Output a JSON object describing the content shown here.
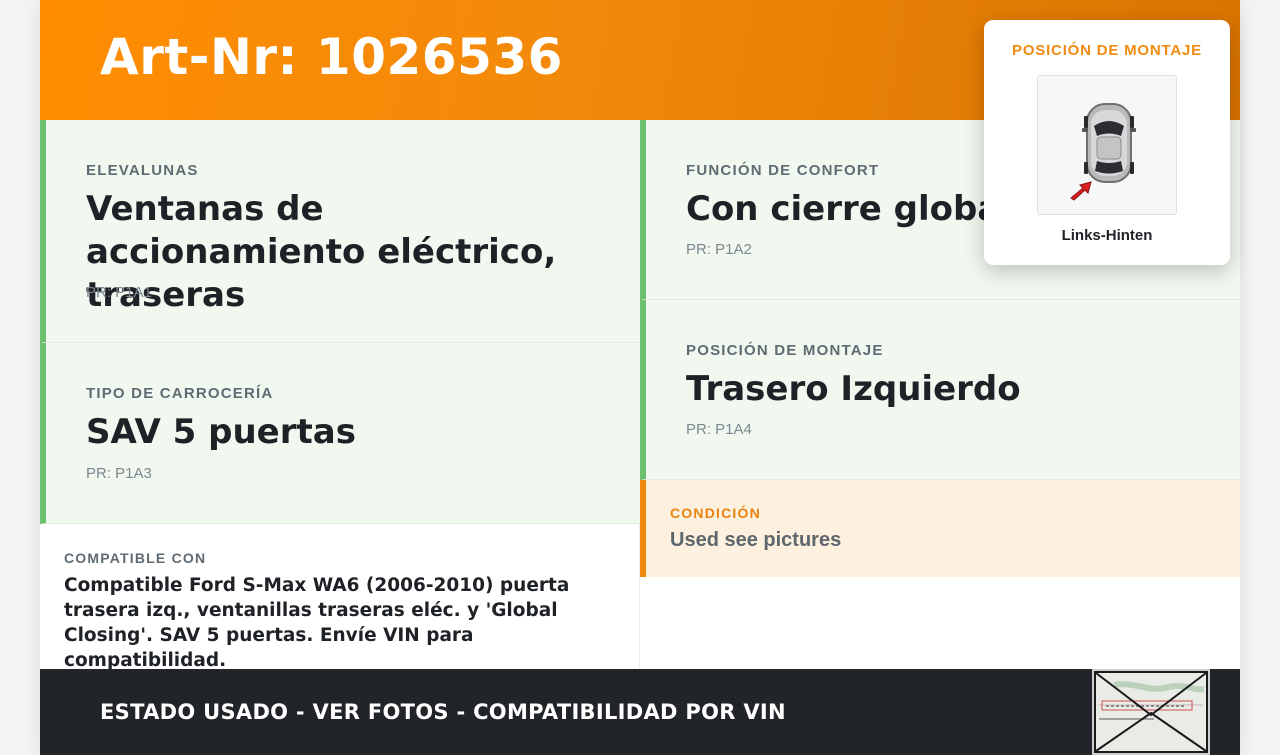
{
  "header": {
    "art_title": "Art-Nr: 1026536"
  },
  "cells": [
    {
      "label": "ELEVALUNAS",
      "value": "Ventanas de accionamiento eléctrico, traseras",
      "pr": "PR: P1A1"
    },
    {
      "label": "TIPO DE CARROCERÍA",
      "value": "SAV 5 puertas",
      "pr": "PR: P1A3"
    },
    {
      "label": "FUNCIÓN DE CONFORT",
      "value": "Con cierre global",
      "pr": "PR: P1A2"
    },
    {
      "label": "POSICIÓN DE MONTAJE",
      "value": "Trasero Izquierdo",
      "pr": "PR: P1A4"
    }
  ],
  "condition": {
    "label": "CONDICIÓN",
    "value": "Used see pictures"
  },
  "compatible": {
    "label": "COMPATIBLE CON",
    "value": "Compatible Ford S-Max WA6 (2006-2010) puerta trasera izq., ventanillas traseras eléc. y 'Global Closing'. SAV 5 puertas. Envíe VIN para compatibilidad."
  },
  "footer": {
    "text": "ESTADO USADO - VER FOTOS - COMPATIBILIDAD POR VIN"
  },
  "popup": {
    "title": "POSICIÓN DE MONTAJE",
    "caption": "Links-Hinten"
  },
  "colors": {
    "accent_orange": "#ff8c00",
    "cell_border_green": "#6cbf6c",
    "cell_bg_green": "#f0f8ef",
    "footer_bg": "#212428",
    "condition_bg": "#fdf0df",
    "position_arrow": "#e02020"
  },
  "icons": {
    "popup_image": "car-top-view-icon",
    "position_marker": "red-arrow-icon",
    "document_thumbnail": "vehicle-registration-document-icon"
  }
}
